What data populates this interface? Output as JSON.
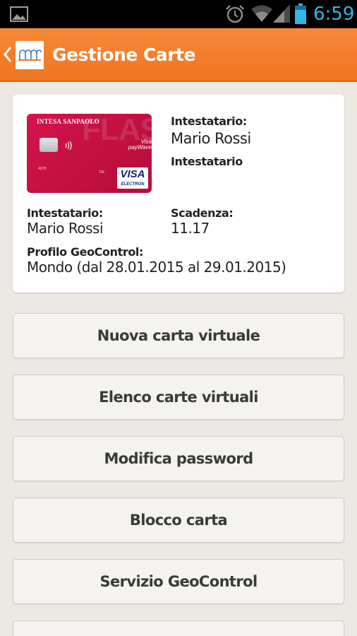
{
  "status_bar": {
    "time": "6:59",
    "icons": [
      "gallery-icon",
      "alarm-icon",
      "wifi-icon",
      "signal-icon",
      "battery-icon"
    ],
    "accent_color": "#33b5e5"
  },
  "action_bar": {
    "title": "Gestione Carte",
    "color": "#f07a28",
    "back_icon": "chevron-left-icon",
    "logo_icon": "bank-logo-icon"
  },
  "card": {
    "brand_text": "INTESA SANPAOLO",
    "product_text": "FLASH",
    "paywave_text": "Visa payWave",
    "visa_text": "VISA",
    "visa_sub": "ELECTRON",
    "header_holder_label": "Intestatario:",
    "header_holder_value": "Mario Rossi",
    "header_role": "Intestatario",
    "holder_label": "Intestatario:",
    "holder_value": "Mario Rossi",
    "expiry_label": "Scadenza:",
    "expiry_value": "11.17",
    "geo_label": "Profilo GeoControl:",
    "geo_value": "Mondo (dal 28.01.2015 al 29.01.2015)"
  },
  "menu": {
    "buttons": [
      {
        "label": "Nuova carta virtuale"
      },
      {
        "label": "Elenco carte virtuali"
      },
      {
        "label": "Modifica password"
      },
      {
        "label": "Blocco carta"
      },
      {
        "label": "Servizio GeoControl"
      },
      {
        "label": ""
      }
    ]
  }
}
